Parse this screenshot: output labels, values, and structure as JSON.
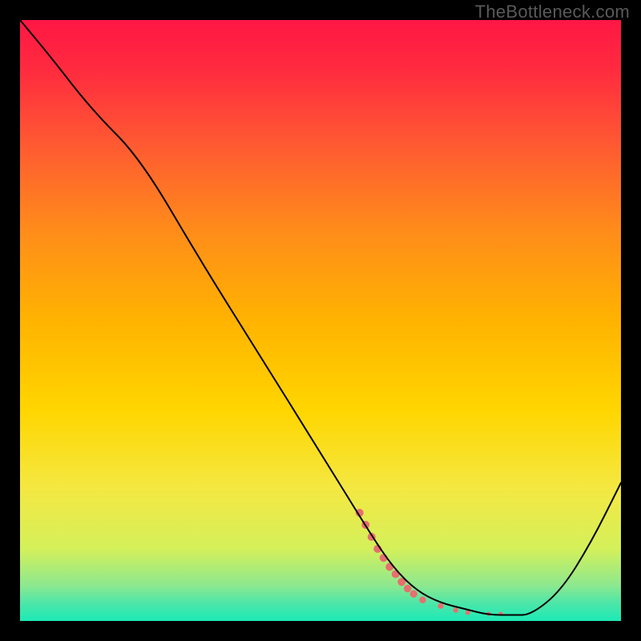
{
  "watermark": "TheBottleneck.com",
  "chart_data": {
    "type": "line",
    "title": "",
    "xlabel": "",
    "ylabel": "",
    "xlim": [
      0,
      100
    ],
    "ylim": [
      0,
      100
    ],
    "grid": false,
    "background_gradient": {
      "stops": [
        {
          "offset": 0.0,
          "color": "#ff1744"
        },
        {
          "offset": 0.08,
          "color": "#ff2a3f"
        },
        {
          "offset": 0.2,
          "color": "#ff5733"
        },
        {
          "offset": 0.35,
          "color": "#ff8c1a"
        },
        {
          "offset": 0.5,
          "color": "#ffb300"
        },
        {
          "offset": 0.65,
          "color": "#ffd600"
        },
        {
          "offset": 0.78,
          "color": "#f4e842"
        },
        {
          "offset": 0.88,
          "color": "#d4f05a"
        },
        {
          "offset": 0.94,
          "color": "#8ee88e"
        },
        {
          "offset": 0.97,
          "color": "#4de6a8"
        },
        {
          "offset": 1.0,
          "color": "#1de9b6"
        }
      ]
    },
    "series": [
      {
        "name": "curve",
        "color": "#000000",
        "stroke_width": 2,
        "x": [
          0,
          5,
          12,
          20,
          30,
          40,
          50,
          58,
          62,
          66,
          70,
          74,
          78,
          82,
          85,
          90,
          95,
          100
        ],
        "y": [
          100,
          94,
          85,
          77,
          60,
          44,
          28,
          15,
          9,
          5,
          3,
          2,
          1,
          1,
          1,
          5,
          13,
          23
        ]
      }
    ],
    "markers": {
      "name": "highlight-dots",
      "color": "#e76f6f",
      "shape": "circle",
      "points": [
        {
          "x": 56.5,
          "y": 18,
          "r": 5.0
        },
        {
          "x": 57.5,
          "y": 16,
          "r": 5.0
        },
        {
          "x": 58.5,
          "y": 14,
          "r": 5.0
        },
        {
          "x": 59.5,
          "y": 12,
          "r": 5.0
        },
        {
          "x": 60.5,
          "y": 10.5,
          "r": 5.0
        },
        {
          "x": 61.5,
          "y": 9.0,
          "r": 5.0
        },
        {
          "x": 62.5,
          "y": 7.8,
          "r": 5.0
        },
        {
          "x": 63.5,
          "y": 6.5,
          "r": 5.0
        },
        {
          "x": 64.5,
          "y": 5.4,
          "r": 4.8
        },
        {
          "x": 65.5,
          "y": 4.5,
          "r": 4.6
        },
        {
          "x": 67.0,
          "y": 3.5,
          "r": 4.2
        },
        {
          "x": 70.0,
          "y": 2.5,
          "r": 3.6
        },
        {
          "x": 72.5,
          "y": 1.8,
          "r": 3.2
        },
        {
          "x": 74.5,
          "y": 1.4,
          "r": 3.0
        },
        {
          "x": 78.0,
          "y": 1.2,
          "r": 2.6
        },
        {
          "x": 80.0,
          "y": 1.2,
          "r": 2.6
        }
      ]
    }
  }
}
